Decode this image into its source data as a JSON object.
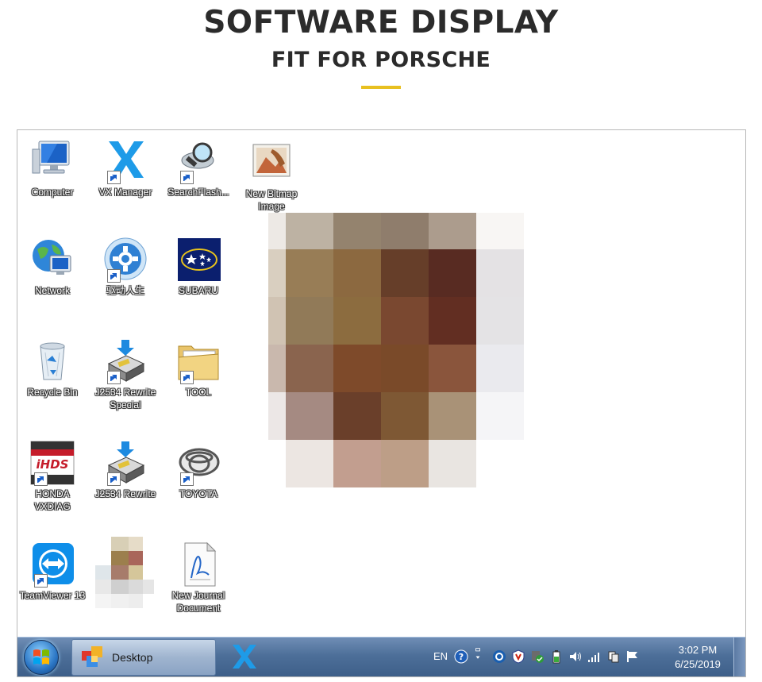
{
  "header": {
    "title": "SOFTWARE DISPLAY",
    "subtitle": "FIT FOR PORSCHE",
    "accent_color": "#e8c020"
  },
  "desktop": {
    "icons": [
      {
        "label": "Computer",
        "icon": "computer-icon"
      },
      {
        "label": "VX Manager",
        "icon": "vx-manager-icon"
      },
      {
        "label": "SearchFlash...",
        "icon": "search-flash-icon"
      },
      {
        "label": "New Bitmap Image",
        "icon": "bitmap-image-icon"
      },
      {
        "label": "Network",
        "icon": "network-icon"
      },
      {
        "label": "驱动人生",
        "icon": "driver-settings-icon"
      },
      {
        "label": "SUBARU",
        "icon": "subaru-icon"
      },
      {
        "label": "Recycle Bin",
        "icon": "recycle-bin-icon"
      },
      {
        "label": "J2534 Rewrite Special",
        "icon": "j2534-special-icon"
      },
      {
        "label": "TOOL",
        "icon": "folder-icon"
      },
      {
        "label": "HONDA VXDIAG",
        "icon": "honda-hds-icon"
      },
      {
        "label": "J2534 Rewrite",
        "icon": "j2534-rewrite-icon"
      },
      {
        "label": "TOYOTA",
        "icon": "toyota-icon"
      },
      {
        "label": "TeamViewer 13",
        "icon": "teamviewer-icon"
      },
      {
        "label": "New Journal Document",
        "icon": "journal-document-icon"
      }
    ]
  },
  "taskbar": {
    "desktop_label": "Desktop",
    "language": "EN",
    "time": "3:02 PM",
    "date": "6/25/2019"
  }
}
